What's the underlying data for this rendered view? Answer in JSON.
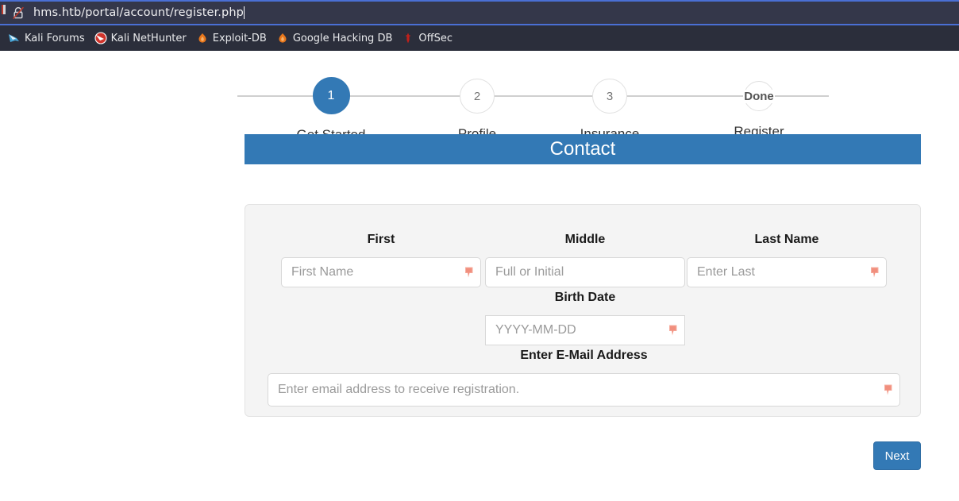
{
  "browser": {
    "url": "hms.htb/portal/account/register.php",
    "security_icon": "crossed-padlock-not-secure-icon",
    "bookmarks": [
      {
        "label": "Kali Forums",
        "icon": "kali-dragon-icon",
        "color": "#4aa7d8"
      },
      {
        "label": "Kali NetHunter",
        "icon": "kali-nethunter-icon",
        "color": "#d0342c"
      },
      {
        "label": "Exploit-DB",
        "icon": "exploit-db-flame-icon",
        "color": "#e8761b"
      },
      {
        "label": "Google Hacking DB",
        "icon": "google-hacking-db-flame-icon",
        "color": "#e8761b"
      },
      {
        "label": "OffSec",
        "icon": "offsec-dagger-icon",
        "color": "#c0201a"
      }
    ]
  },
  "theme": {
    "accent": "#3379b5",
    "panel_bg": "#f4f4f4",
    "banner_bg": "#3379b5",
    "chrome_bg": "#2b2e3b",
    "urlbar_bg": "#34374a",
    "required_flag": "#f2a396"
  },
  "stepper": {
    "steps": [
      {
        "marker": "1",
        "label": "Get Started",
        "state": "active"
      },
      {
        "marker": "2",
        "label": "Profile",
        "state": "inactive"
      },
      {
        "marker": "3",
        "label": "Insurance",
        "state": "inactive"
      },
      {
        "marker": "Done",
        "label": "Register",
        "state": "inactive"
      }
    ]
  },
  "banner": {
    "title": "Contact"
  },
  "form": {
    "fields": {
      "first": {
        "label": "First",
        "placeholder": "First Name",
        "value": "",
        "required": true
      },
      "middle": {
        "label": "Middle",
        "placeholder": "Full or Initial",
        "value": "",
        "required": false
      },
      "last": {
        "label": "Last Name",
        "placeholder": "Enter Last",
        "value": "",
        "required": true
      },
      "birth_date": {
        "label": "Birth Date",
        "placeholder": "YYYY-MM-DD",
        "value": "",
        "required": true
      },
      "email": {
        "label": "Enter E-Mail Address",
        "placeholder": "Enter email address to receive registration.",
        "value": "",
        "required": true
      }
    }
  },
  "actions": {
    "next_label": "Next"
  }
}
